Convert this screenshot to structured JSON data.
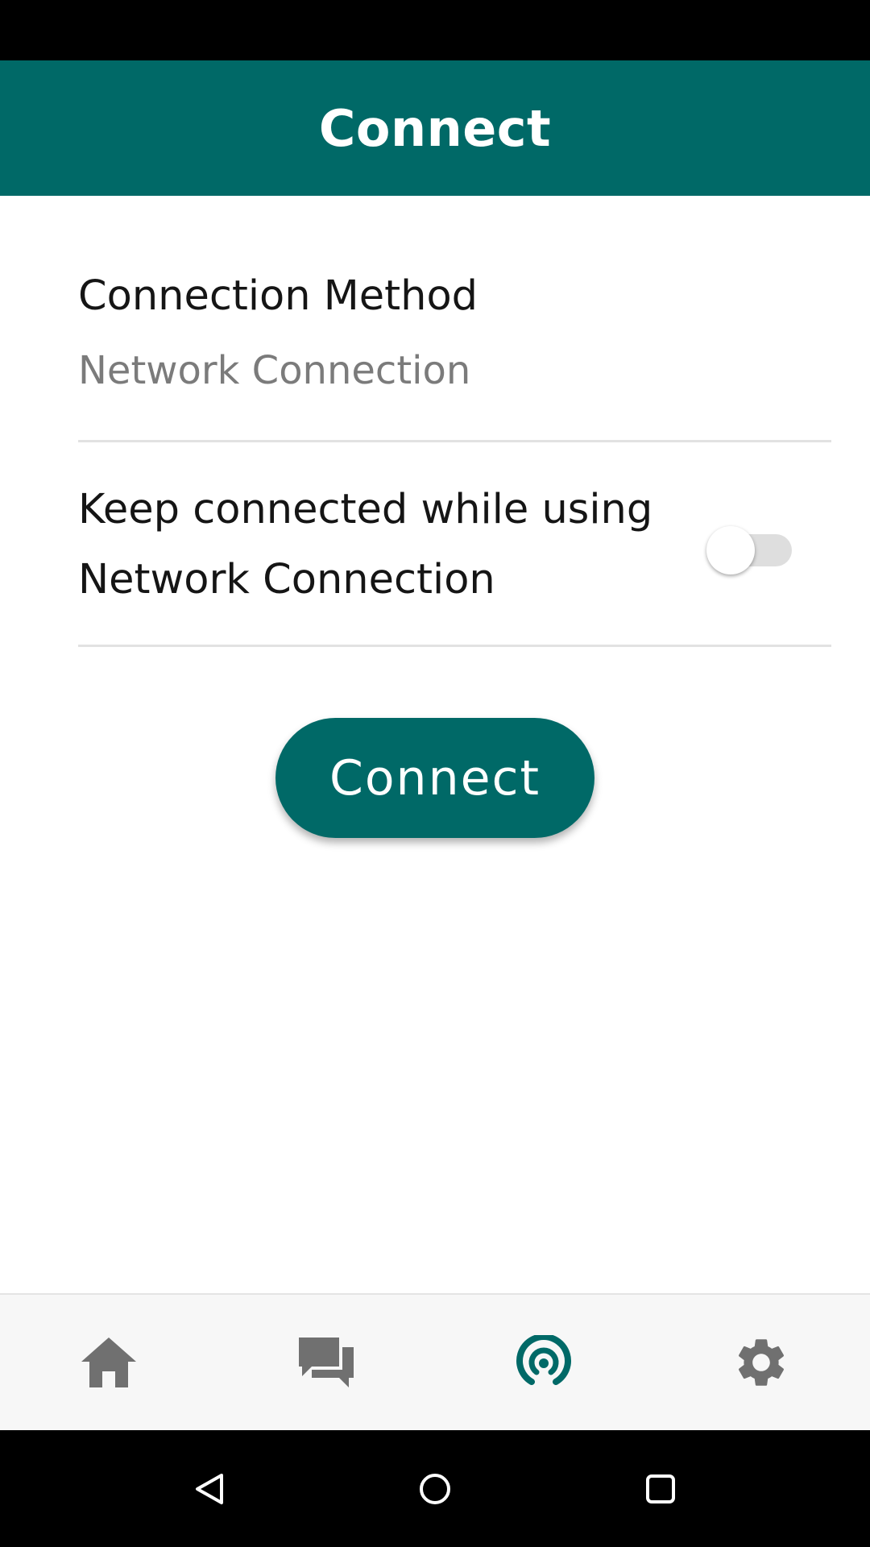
{
  "app_bar": {
    "title": "Connect",
    "color": "#006967"
  },
  "connection_method": {
    "label": "Connection Method",
    "value": "Network Connection"
  },
  "keep_connected": {
    "label": "Keep connected while using Network Connection",
    "enabled": false
  },
  "connect_button": {
    "label": "Connect"
  },
  "bottom_nav": {
    "items": [
      {
        "icon": "home-icon",
        "selected": false
      },
      {
        "icon": "chat-icon",
        "selected": false
      },
      {
        "icon": "connect-signal-icon",
        "selected": true
      },
      {
        "icon": "gear-icon",
        "selected": false
      }
    ],
    "selected_color": "#006967",
    "unselected_color": "#707070"
  },
  "system_nav": {
    "items": [
      "back-icon",
      "home-circle-icon",
      "recents-icon"
    ]
  }
}
